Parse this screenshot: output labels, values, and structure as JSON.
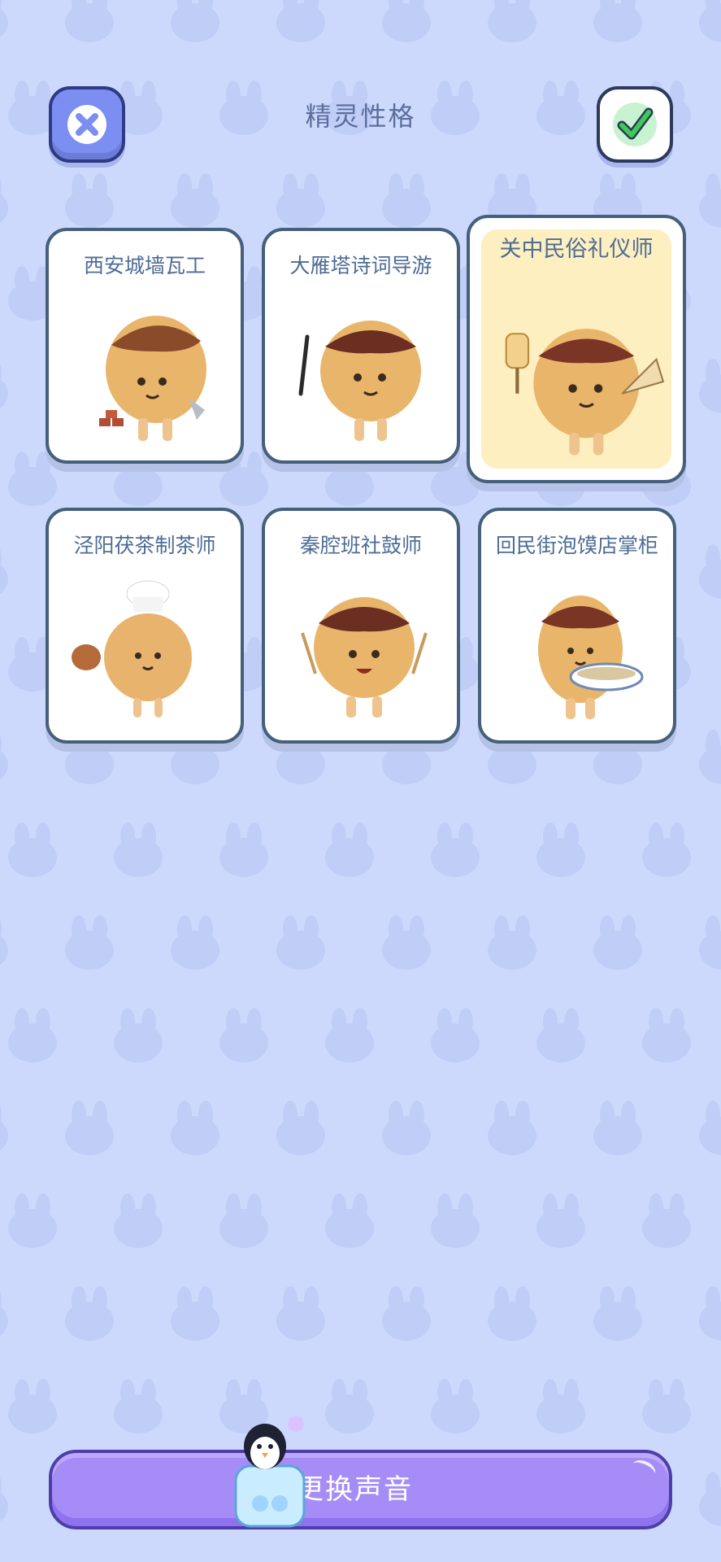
{
  "header": {
    "title": "精灵性格",
    "close_icon": "close-x-icon",
    "confirm_icon": "checkmark-icon"
  },
  "personalities": [
    {
      "name": "西安城墙瓦工",
      "prop": "trowel-and-bricks",
      "selected": false
    },
    {
      "name": "大雁塔诗词导游",
      "prop": "calligraphy-brush",
      "selected": false
    },
    {
      "name": "关中民俗礼仪师",
      "prop": "fan-and-sign",
      "selected": true
    },
    {
      "name": "泾阳茯茶制茶师",
      "prop": "chef-hat-and-teapot",
      "selected": false
    },
    {
      "name": "秦腔班社鼓师",
      "prop": "drumsticks",
      "selected": false
    },
    {
      "name": "回民街泡馍店掌柜",
      "prop": "bowl-of-soup",
      "selected": false
    }
  ],
  "footer": {
    "change_voice_label": "更换声音",
    "mascot_icon": "penguin-mascot-icon"
  },
  "colors": {
    "background": "#cdd9fc",
    "pattern": "#bfcdf7",
    "selected_card": "#fdefbf",
    "button_purple": "#a68cf7",
    "title_text": "#5b6e9c",
    "card_text": "#4e6c95"
  }
}
